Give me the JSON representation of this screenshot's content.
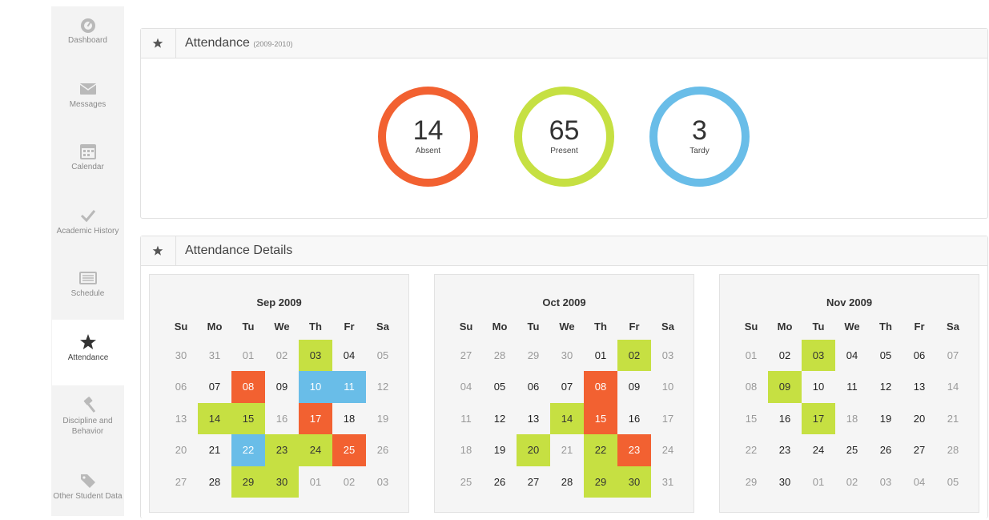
{
  "colors": {
    "absent": "#f26131",
    "present": "#c6e042",
    "tardy": "#69bde8"
  },
  "sidebar": {
    "items": [
      {
        "label": "Dashboard",
        "icon": "dashboard-icon"
      },
      {
        "label": "Messages",
        "icon": "envelope-icon"
      },
      {
        "label": "Calendar",
        "icon": "calendar-icon"
      },
      {
        "label": "Academic History",
        "icon": "checkmark-icon"
      },
      {
        "label": "Schedule",
        "icon": "schedule-icon"
      },
      {
        "label": "Attendance",
        "icon": "star-icon",
        "active": true
      },
      {
        "label": "Discipline and Behavior",
        "icon": "gavel-icon"
      },
      {
        "label": "Other Student Data",
        "icon": "tags-icon"
      }
    ]
  },
  "attendance": {
    "title": "Attendance",
    "year": "(2009-2010)",
    "stats": [
      {
        "value": "14",
        "label": "Absent",
        "color": "#f26131"
      },
      {
        "value": "65",
        "label": "Present",
        "color": "#c6e042"
      },
      {
        "value": "3",
        "label": "Tardy",
        "color": "#69bde8"
      }
    ]
  },
  "details": {
    "title": "Attendance Details",
    "weekdays": [
      "Su",
      "Mo",
      "Tu",
      "We",
      "Th",
      "Fr",
      "Sa"
    ],
    "calendars": [
      {
        "month": "Sep 2009",
        "weeks": [
          [
            {
              "d": "30",
              "m": 1
            },
            {
              "d": "31",
              "m": 1
            },
            {
              "d": "01",
              "m": 1
            },
            {
              "d": "02",
              "m": 1
            },
            {
              "d": "03",
              "s": "present"
            },
            {
              "d": "04"
            },
            {
              "d": "05",
              "m": 1
            }
          ],
          [
            {
              "d": "06",
              "m": 1
            },
            {
              "d": "07"
            },
            {
              "d": "08",
              "s": "absent"
            },
            {
              "d": "09"
            },
            {
              "d": "10",
              "s": "tardy"
            },
            {
              "d": "11",
              "s": "tardy"
            },
            {
              "d": "12",
              "m": 1
            }
          ],
          [
            {
              "d": "13",
              "m": 1
            },
            {
              "d": "14",
              "s": "present"
            },
            {
              "d": "15",
              "s": "present"
            },
            {
              "d": "16",
              "m": 1
            },
            {
              "d": "17",
              "s": "absent"
            },
            {
              "d": "18"
            },
            {
              "d": "19",
              "m": 1
            }
          ],
          [
            {
              "d": "20",
              "m": 1
            },
            {
              "d": "21"
            },
            {
              "d": "22",
              "s": "tardy"
            },
            {
              "d": "23",
              "s": "present"
            },
            {
              "d": "24",
              "s": "present"
            },
            {
              "d": "25",
              "s": "absent"
            },
            {
              "d": "26",
              "m": 1
            }
          ],
          [
            {
              "d": "27",
              "m": 1
            },
            {
              "d": "28"
            },
            {
              "d": "29",
              "s": "present"
            },
            {
              "d": "30",
              "s": "present"
            },
            {
              "d": "01",
              "m": 1
            },
            {
              "d": "02",
              "m": 1
            },
            {
              "d": "03",
              "m": 1
            }
          ]
        ]
      },
      {
        "month": "Oct 2009",
        "weeks": [
          [
            {
              "d": "27",
              "m": 1
            },
            {
              "d": "28",
              "m": 1
            },
            {
              "d": "29",
              "m": 1
            },
            {
              "d": "30",
              "m": 1
            },
            {
              "d": "01"
            },
            {
              "d": "02",
              "s": "present"
            },
            {
              "d": "03",
              "m": 1
            }
          ],
          [
            {
              "d": "04",
              "m": 1
            },
            {
              "d": "05"
            },
            {
              "d": "06"
            },
            {
              "d": "07"
            },
            {
              "d": "08",
              "s": "absent"
            },
            {
              "d": "09"
            },
            {
              "d": "10",
              "m": 1
            }
          ],
          [
            {
              "d": "11",
              "m": 1
            },
            {
              "d": "12"
            },
            {
              "d": "13"
            },
            {
              "d": "14",
              "s": "present"
            },
            {
              "d": "15",
              "s": "absent"
            },
            {
              "d": "16"
            },
            {
              "d": "17",
              "m": 1
            }
          ],
          [
            {
              "d": "18",
              "m": 1
            },
            {
              "d": "19"
            },
            {
              "d": "20",
              "s": "present"
            },
            {
              "d": "21",
              "m": 1
            },
            {
              "d": "22",
              "s": "present"
            },
            {
              "d": "23",
              "s": "absent"
            },
            {
              "d": "24",
              "m": 1
            }
          ],
          [
            {
              "d": "25",
              "m": 1
            },
            {
              "d": "26"
            },
            {
              "d": "27"
            },
            {
              "d": "28"
            },
            {
              "d": "29",
              "s": "present"
            },
            {
              "d": "30",
              "s": "present"
            },
            {
              "d": "31",
              "m": 1
            }
          ]
        ]
      },
      {
        "month": "Nov 2009",
        "weeks": [
          [
            {
              "d": "01",
              "m": 1
            },
            {
              "d": "02"
            },
            {
              "d": "03",
              "s": "present"
            },
            {
              "d": "04"
            },
            {
              "d": "05"
            },
            {
              "d": "06"
            },
            {
              "d": "07",
              "m": 1
            }
          ],
          [
            {
              "d": "08",
              "m": 1
            },
            {
              "d": "09",
              "s": "present"
            },
            {
              "d": "10"
            },
            {
              "d": "11"
            },
            {
              "d": "12"
            },
            {
              "d": "13"
            },
            {
              "d": "14",
              "m": 1
            }
          ],
          [
            {
              "d": "15",
              "m": 1
            },
            {
              "d": "16"
            },
            {
              "d": "17",
              "s": "present"
            },
            {
              "d": "18",
              "m": 1
            },
            {
              "d": "19"
            },
            {
              "d": "20"
            },
            {
              "d": "21",
              "m": 1
            }
          ],
          [
            {
              "d": "22",
              "m": 1
            },
            {
              "d": "23"
            },
            {
              "d": "24"
            },
            {
              "d": "25"
            },
            {
              "d": "26"
            },
            {
              "d": "27"
            },
            {
              "d": "28",
              "m": 1
            }
          ],
          [
            {
              "d": "29",
              "m": 1
            },
            {
              "d": "30"
            },
            {
              "d": "01",
              "m": 1
            },
            {
              "d": "02",
              "m": 1
            },
            {
              "d": "03",
              "m": 1
            },
            {
              "d": "04",
              "m": 1
            },
            {
              "d": "05",
              "m": 1
            }
          ]
        ]
      }
    ]
  }
}
